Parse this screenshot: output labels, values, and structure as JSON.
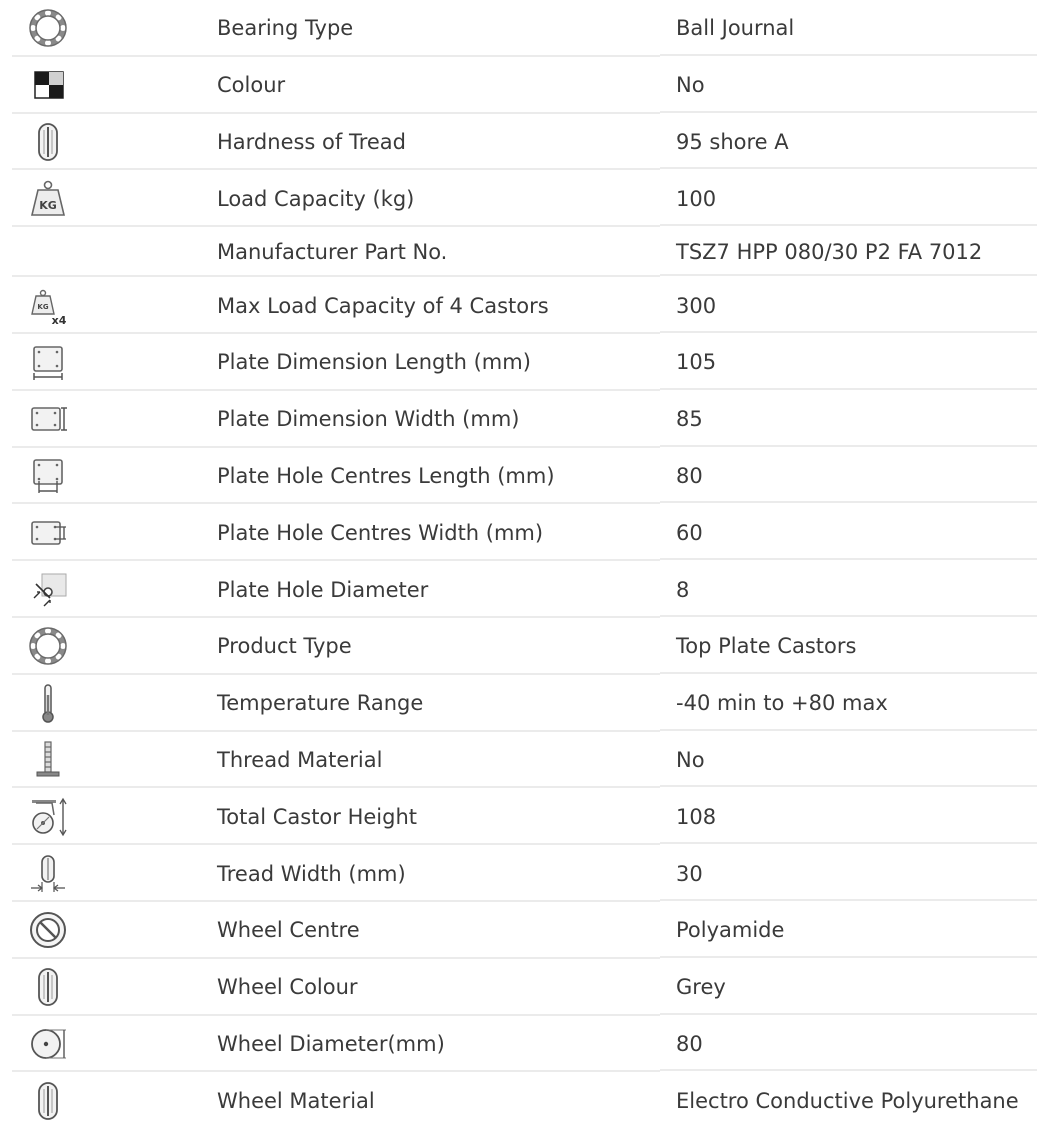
{
  "spec_rows": [
    {
      "icon": "bearing-ring-icon",
      "label": "Bearing Type",
      "value": "Ball Journal"
    },
    {
      "icon": "colour-swatch-icon",
      "label": "Colour",
      "value": "No"
    },
    {
      "icon": "wheel-tread-icon",
      "label": "Hardness of Tread",
      "value": "95 shore A"
    },
    {
      "icon": "kg-weight-icon",
      "label": "Load Capacity (kg)",
      "value": "100",
      "icon_text": "KG"
    },
    {
      "icon": "",
      "label": "Manufacturer Part No.",
      "value": "TSZ7 HPP 080/30 P2 FA 7012"
    },
    {
      "icon": "kg-weight-x4-icon",
      "label": "Max Load Capacity of 4 Castors",
      "value": "300",
      "icon_text": "KG",
      "icon_text_2": "x4"
    },
    {
      "icon": "plate-length-icon",
      "label": "Plate Dimension Length (mm)",
      "value": "105"
    },
    {
      "icon": "plate-width-icon",
      "label": "Plate Dimension Width (mm)",
      "value": "85"
    },
    {
      "icon": "plate-hole-centres-length-icon",
      "label": "Plate Hole Centres Length (mm)",
      "value": "80"
    },
    {
      "icon": "plate-hole-centres-width-icon",
      "label": "Plate Hole Centres Width (mm)",
      "value": "60"
    },
    {
      "icon": "plate-hole-diameter-icon",
      "label": "Plate Hole Diameter",
      "value": "8"
    },
    {
      "icon": "bearing-ring-icon",
      "label": "Product Type",
      "value": "Top Plate Castors"
    },
    {
      "icon": "thermometer-icon",
      "label": "Temperature Range",
      "value": "-40 min to +80 max"
    },
    {
      "icon": "thread-stem-icon",
      "label": "Thread Material",
      "value": "No"
    },
    {
      "icon": "castor-height-icon",
      "label": "Total Castor Height",
      "value": "108"
    },
    {
      "icon": "tread-width-icon",
      "label": "Tread Width (mm)",
      "value": "30"
    },
    {
      "icon": "wheel-centre-icon",
      "label": "Wheel Centre",
      "value": "Polyamide"
    },
    {
      "icon": "wheel-tread-icon",
      "label": "Wheel Colour",
      "value": "Grey"
    },
    {
      "icon": "wheel-diameter-icon",
      "label": "Wheel Diameter(mm)",
      "value": "80"
    },
    {
      "icon": "wheel-tread-icon",
      "label": "Wheel Material",
      "value": "Electro Conductive Polyurethane"
    }
  ]
}
